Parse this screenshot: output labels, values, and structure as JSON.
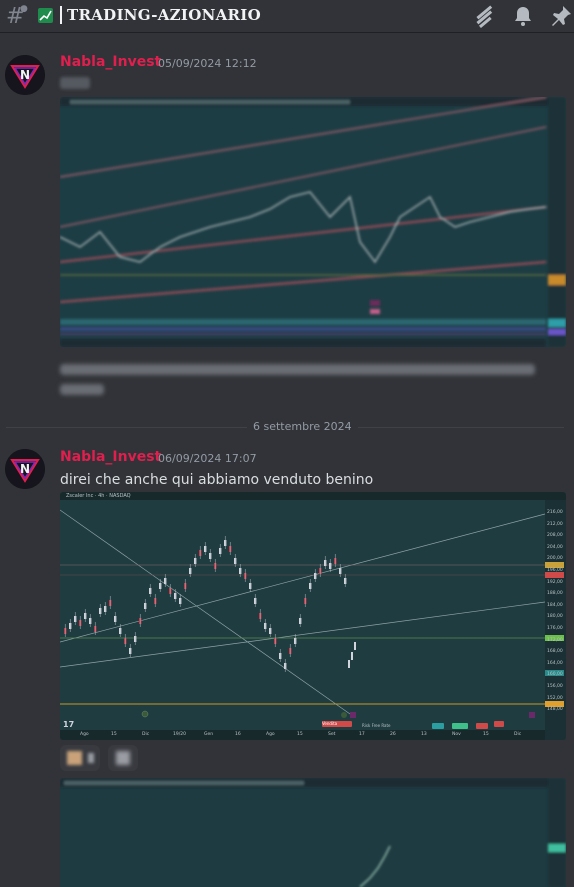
{
  "channel": {
    "name": "TRADING-AZIONARIO",
    "emoji": "chart-increasing-icon"
  },
  "messages": [
    {
      "author": "Nabla_Invest",
      "timestamp": "05/09/2024 12:12",
      "text_blurred": true
    },
    {
      "author": "Nabla_Invest",
      "timestamp": "06/09/2024 17:07",
      "text": "direi che anche qui abbiamo venduto benino"
    }
  ],
  "date_divider": "6 settembre 2024",
  "chart2": {
    "header": "Zscaler Inc · 4h · NASDAQ",
    "price_labels": [
      "216,00",
      "212,00",
      "208,00",
      "204,00",
      "200,00",
      "196,00",
      "192,00",
      "188,00",
      "184,00",
      "180,00",
      "176,00",
      "172,00",
      "168,00",
      "164,00",
      "160,00",
      "156,00",
      "152,00",
      "148,00"
    ],
    "x_labels": [
      "Ago",
      "15",
      "Dic",
      "19/20",
      "Gen",
      "16",
      "Ago",
      "15",
      "Set",
      "17",
      "26",
      "13",
      "Nov",
      "15",
      "Dic"
    ],
    "tags": [
      "Vendita",
      "Risk Free Rate"
    ]
  },
  "colors": {
    "accent_username": "#e01f4e",
    "background": "#313338",
    "chart_bg": "#1e3a3f"
  }
}
